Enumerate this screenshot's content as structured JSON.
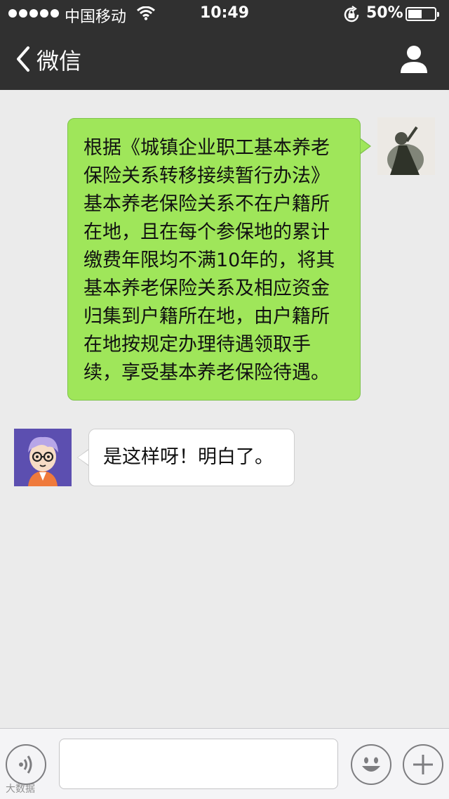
{
  "status_bar": {
    "carrier": "中国移动",
    "time": "10:49",
    "battery_percent": "50%",
    "battery_level": 0.5,
    "signal_bars": 5
  },
  "nav": {
    "back_label": "微信",
    "back_icon": "chevron-left-icon",
    "profile_icon": "person-icon"
  },
  "messages": [
    {
      "side": "right",
      "text": "根据《城镇企业职工基本养老保险关系转移接续暂行办法》基本养老保险关系不在户籍所在地，且在每个参保地的累计缴费年限均不满10年的，将其基本养老保险关系及相应资金归集到户籍所在地，由户籍所在地按规定办理待遇领取手续，享受基本养老保险待遇。"
    },
    {
      "side": "left",
      "text": "是这样呀！明白了。"
    }
  ],
  "input_bar": {
    "voice_icon": "voice-icon",
    "emoji_icon": "emoji-icon",
    "plus_icon": "plus-icon",
    "value": ""
  },
  "watermark": "大数据",
  "colors": {
    "nav_bg": "#303030",
    "chat_bg": "#ebebeb",
    "sent_bubble": "#9fe65a",
    "received_bubble": "#ffffff"
  }
}
